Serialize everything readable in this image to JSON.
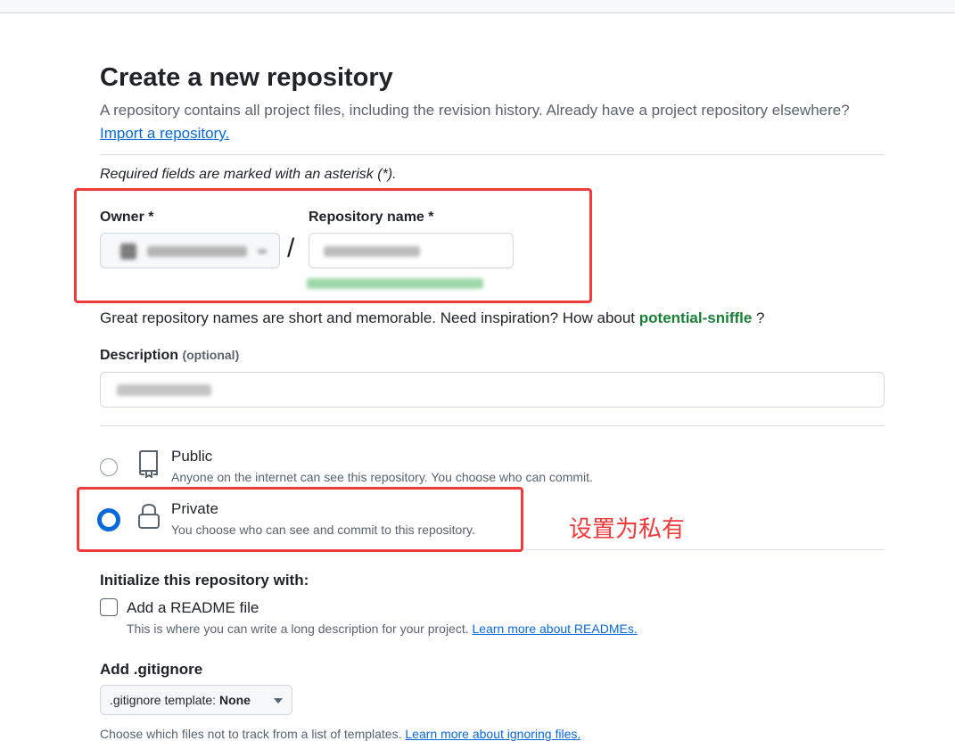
{
  "header": {
    "title": "Create a new repository",
    "subtitle": "A repository contains all project files, including the revision history. Already have a project repository elsewhere?",
    "import_link": "Import a repository."
  },
  "form": {
    "required_note": "Required fields are marked with an asterisk (*).",
    "owner_label": "Owner *",
    "slash": "/",
    "repo_name_label": "Repository name *",
    "inspiration_text": "Great repository names are short and memorable. Need inspiration? How about",
    "suggestion": "potential-sniffle",
    "inspiration_end": " ?",
    "description_label": "Description",
    "description_optional": "(optional)"
  },
  "visibility": {
    "public_title": "Public",
    "public_desc": "Anyone on the internet can see this repository. You choose who can commit.",
    "private_title": "Private",
    "private_desc": "You choose who can see and commit to this repository.",
    "selected": "private"
  },
  "annotation": {
    "text": "设置为私有",
    "color": "#ef3b3b"
  },
  "initialize": {
    "title": "Initialize this repository with:",
    "readme_label": "Add a README file",
    "readme_desc": "This is where you can write a long description for your project.",
    "readme_link": "Learn more about READMEs.",
    "gitignore_title": "Add .gitignore",
    "gitignore_prefix": ".gitignore template: ",
    "gitignore_value": "None",
    "gitignore_desc": "Choose which files not to track from a list of templates.",
    "gitignore_link": "Learn more about ignoring files."
  },
  "colors": {
    "link": "#0969da",
    "suggestion": "#1a7f37",
    "radio_selected": "#0969da"
  }
}
